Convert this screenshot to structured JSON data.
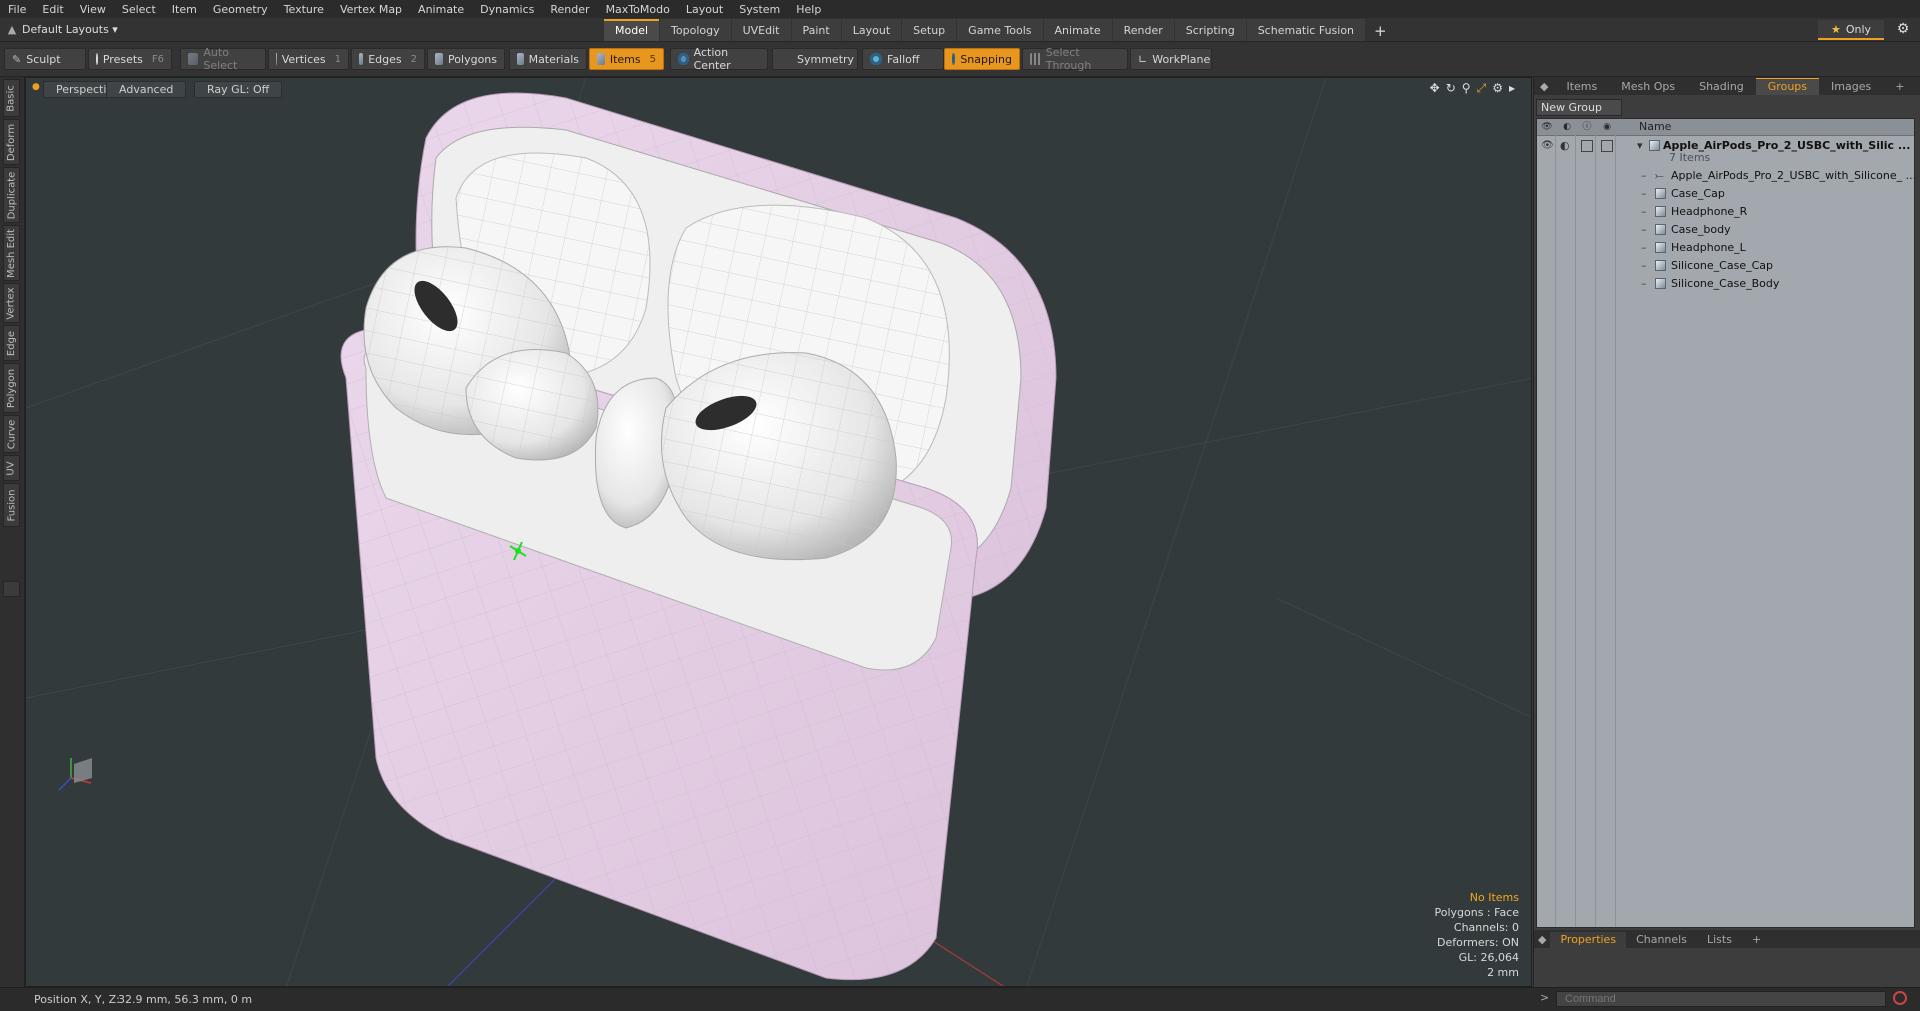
{
  "menu": [
    "File",
    "Edit",
    "View",
    "Select",
    "Item",
    "Geometry",
    "Texture",
    "Vertex Map",
    "Animate",
    "Dynamics",
    "Render",
    "MaxToModo",
    "Layout",
    "System",
    "Help"
  ],
  "layout_select": "Default Layouts ▾",
  "layout_tabs": [
    "Model",
    "Topology",
    "UVEdit",
    "Paint",
    "Layout",
    "Setup",
    "Game Tools",
    "Animate",
    "Render",
    "Scripting",
    "Schematic Fusion"
  ],
  "active_layout_tab": "Model",
  "only_label": "Only",
  "toolbar": {
    "sculpt": "Sculpt",
    "presets": "Presets",
    "presets_key": "F6",
    "auto_select": "Auto Select",
    "vertices": "Vertices",
    "vertices_key": "1",
    "edges": "Edges",
    "edges_key": "2",
    "polygons": "Polygons",
    "materials": "Materials",
    "items": "Items",
    "items_key": "5",
    "action_center": "Action Center",
    "symmetry": "Symmetry",
    "falloff": "Falloff",
    "snapping": "Snapping",
    "select_through": "Select Through",
    "workplane": "WorkPlane"
  },
  "left_tabs": [
    "Basic",
    "Deform",
    "Duplicate",
    "Mesh Edit",
    "Vertex",
    "Edge",
    "Polygon",
    "Curve",
    "UV",
    "Fusion"
  ],
  "viewport": {
    "perspective": "Perspective",
    "advanced": "Advanced",
    "raygl": "Ray GL: Off",
    "info": {
      "selection": "No Items",
      "polygons": "Polygons : Face",
      "channels": "Channels: 0",
      "deformers": "Deformers: ON",
      "gl": "GL: 26,064",
      "scale": "2 mm"
    }
  },
  "right_tabs": [
    "Items",
    "Mesh Ops",
    "Shading",
    "Groups",
    "Images"
  ],
  "active_right_tab": "Groups",
  "new_group": "New Group",
  "tree": {
    "name_header": "Name",
    "group_name": "Apple_AirPods_Pro_2_USBC_with_Silic ...",
    "group_count": "7 Items",
    "items": [
      "Apple_AirPods_Pro_2_USBC_with_Silicone_ ...",
      "Case_Cap",
      "Headphone_R",
      "Case_body",
      "Headphone_L",
      "Silicone_Case_Cap",
      "Silicone_Case_Body"
    ]
  },
  "prop_tabs": [
    "Properties",
    "Channels",
    "Lists"
  ],
  "active_prop_tab": "Properties",
  "status": {
    "position_label": "Position X, Y, Z:",
    "position_value": "32.9 mm, 56.3 mm, 0 m"
  },
  "command_placeholder": "Command",
  "colors": {
    "accent": "#f0a020",
    "viewport_bg": "#333a3c",
    "case_pink": "#e6cfe6"
  }
}
